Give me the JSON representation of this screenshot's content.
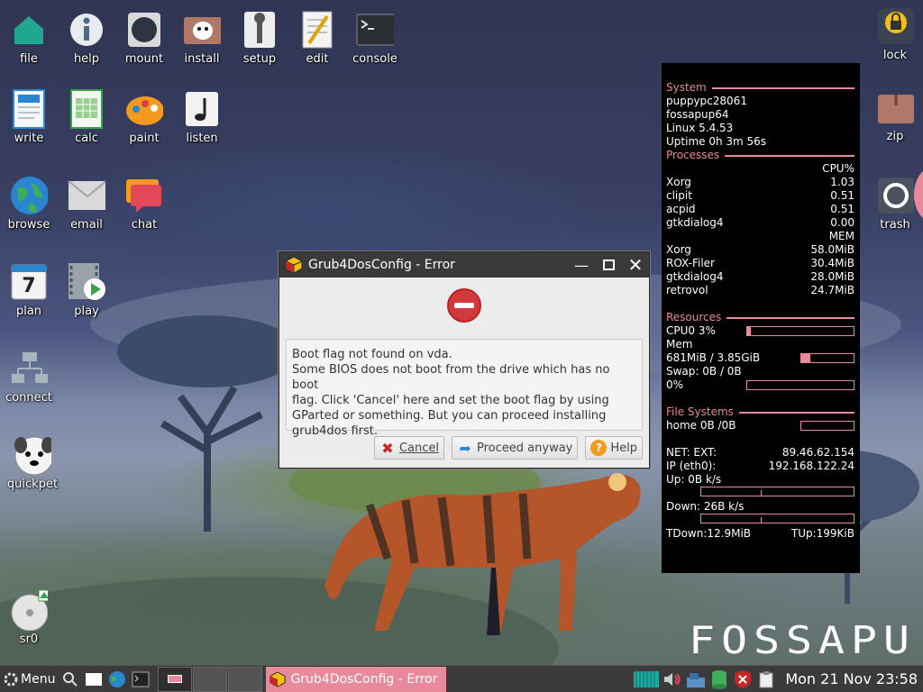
{
  "desktop_icons": [
    {
      "name": "file",
      "label": "file"
    },
    {
      "name": "help",
      "label": "help"
    },
    {
      "name": "mount",
      "label": "mount"
    },
    {
      "name": "install",
      "label": "install"
    },
    {
      "name": "setup",
      "label": "setup"
    },
    {
      "name": "edit",
      "label": "edit"
    },
    {
      "name": "console",
      "label": "console"
    },
    {
      "name": "write",
      "label": "write"
    },
    {
      "name": "calc",
      "label": "calc"
    },
    {
      "name": "paint",
      "label": "paint"
    },
    {
      "name": "listen",
      "label": "listen"
    },
    {
      "name": "browse",
      "label": "browse"
    },
    {
      "name": "email",
      "label": "email"
    },
    {
      "name": "chat",
      "label": "chat"
    },
    {
      "name": "plan",
      "label": "plan"
    },
    {
      "name": "play",
      "label": "play"
    },
    {
      "name": "connect",
      "label": "connect"
    },
    {
      "name": "quickpet",
      "label": "quickpet"
    },
    {
      "name": "sr0",
      "label": "sr0"
    },
    {
      "name": "lock",
      "label": "lock"
    },
    {
      "name": "zip",
      "label": "zip"
    },
    {
      "name": "trash",
      "label": "trash"
    }
  ],
  "plan_day": "7",
  "conky": {
    "system_header": "System",
    "hostname": "puppypc28061",
    "distro": "fossapup64",
    "kernel": "Linux 5.4.53",
    "uptime": "Uptime 0h 3m 56s",
    "processes_header": "Processes",
    "cpu_col": "CPU%",
    "cpu_procs": [
      {
        "name": "Xorg",
        "value": "1.03"
      },
      {
        "name": "clipit",
        "value": "0.51"
      },
      {
        "name": "acpid",
        "value": "0.51"
      },
      {
        "name": "gtkdialog4",
        "value": "0.00"
      }
    ],
    "mem_col": "MEM",
    "mem_procs": [
      {
        "name": "Xorg",
        "value": "58.0MiB"
      },
      {
        "name": "ROX-Filer",
        "value": "30.4MiB"
      },
      {
        "name": "gtkdialog4",
        "value": "28.0MiB"
      },
      {
        "name": "retrovol",
        "value": "24.7MiB"
      }
    ],
    "resources_header": "Resources",
    "cpu0": "CPU0 3%",
    "cpu0_fraction": 0.03,
    "mem_label": "Mem",
    "mem_value": "681MiB / 3.85GiB",
    "mem_fraction": 0.17,
    "swap": "Swap: 0B  / 0B",
    "swap_pct": "0%",
    "swap_fraction": 0.0,
    "fs_header": "File Systems",
    "home": "home 0B  /0B",
    "home_fraction": 0.0,
    "net_ext_label": "NET: EXT:",
    "net_ext_ip": "89.46.62.154",
    "ip_label": "IP (eth0):",
    "ip_value": "192.168.122.24",
    "up": " Up: 0B   k/s",
    "down": " Down: 26B  k/s",
    "tdown": "TDown:12.9MiB",
    "tup": "TUp:199KiB"
  },
  "dialog": {
    "title": "Grub4DosConfig - Error",
    "message_lines": [
      "Boot flag not found on vda.",
      "Some BIOS does not boot from the drive which has no boot",
      "flag. Click 'Cancel' here and set the boot flag by using",
      "GParted or something. But you can proceed installing",
      "grub4dos first."
    ],
    "cancel_label": "Cancel",
    "proceed_label": "Proceed anyway",
    "help_label": "Help"
  },
  "brand_text": "FOSSAPU",
  "taskbar": {
    "menu_label": "Menu",
    "task_title": "Grub4DosConfig - Error",
    "clock": "Mon 21 Nov 23:58"
  },
  "colors": {
    "conky_accent": "#e8899c",
    "taskbar_bg": "#3b3b3b",
    "active_task": "#e8899c"
  }
}
